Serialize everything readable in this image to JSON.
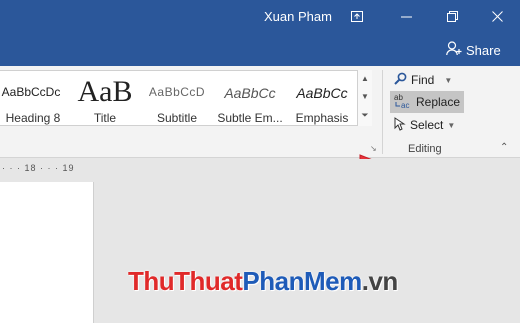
{
  "titlebar": {
    "user_name": "Xuan Pham"
  },
  "share": {
    "label": "Share"
  },
  "styles": [
    {
      "sample": "AaBbCcDc",
      "label": "Heading 8"
    },
    {
      "sample": "AaB",
      "label": "Title"
    },
    {
      "sample": "AaBbCcD",
      "label": "Subtitle"
    },
    {
      "sample": "AaBbCc",
      "label": "Subtle Em..."
    },
    {
      "sample": "AaBbCc",
      "label": "Emphasis"
    }
  ],
  "editing": {
    "find_label": "Find",
    "replace_label": "Replace",
    "select_label": "Select",
    "group_label": "Editing"
  },
  "ruler": {
    "marks": "· · · 18 · · · 19"
  },
  "watermark": {
    "part1": "Thu",
    "part2": "Thuat",
    "part3": "PhanMem",
    "part4": ".vn"
  },
  "colors": {
    "title_bar": "#2b579a",
    "arrow": "#e8323a",
    "highlight": "#c5c5c5"
  }
}
